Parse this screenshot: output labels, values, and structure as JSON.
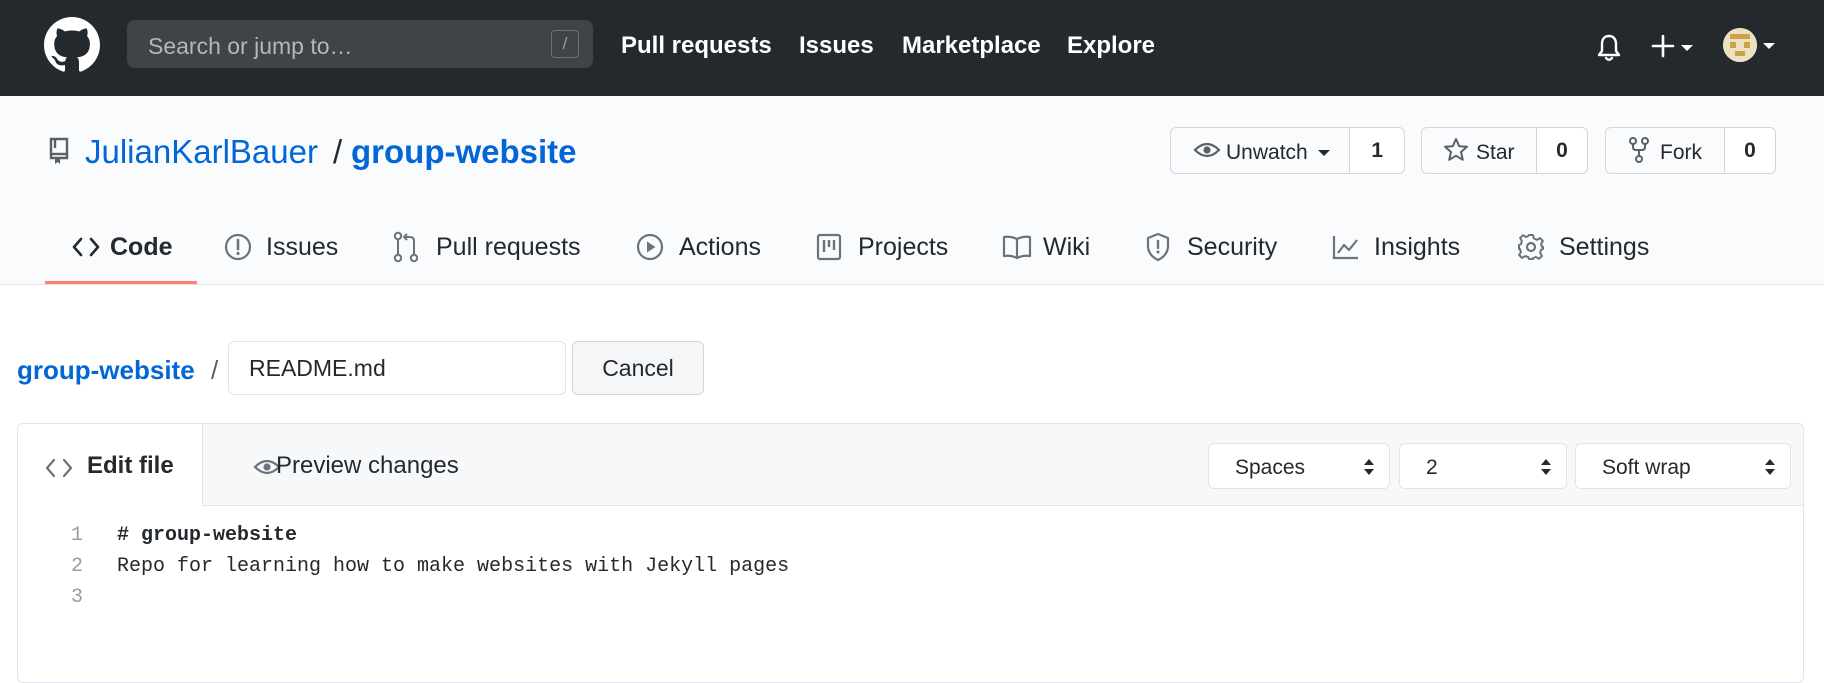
{
  "topnav": {
    "search_placeholder": "Search or jump to…",
    "search_shortcut": "/",
    "links": [
      "Pull requests",
      "Issues",
      "Marketplace",
      "Explore"
    ]
  },
  "repo": {
    "owner": "JulianKarlBauer",
    "separator": "/",
    "name": "group-website",
    "watch": {
      "label": "Unwatch",
      "count": "1"
    },
    "star": {
      "label": "Star",
      "count": "0"
    },
    "fork": {
      "label": "Fork",
      "count": "0"
    }
  },
  "tabs": [
    "Code",
    "Issues",
    "Pull requests",
    "Actions",
    "Projects",
    "Wiki",
    "Security",
    "Insights",
    "Settings"
  ],
  "active_tab": "Code",
  "breadcrumb": {
    "repo": "group-website",
    "separator": "/"
  },
  "filename": {
    "value": "README.md"
  },
  "cancel_label": "Cancel",
  "editor": {
    "edit_tab": "Edit file",
    "preview_tab": "Preview changes",
    "indent_mode": "Spaces",
    "indent_size": "2",
    "wrap_mode": "Soft wrap",
    "lines": [
      {
        "number": "1",
        "text": "# group-website"
      },
      {
        "number": "2",
        "text": "Repo for learning how to make websites with Jekyll pages"
      },
      {
        "number": "3",
        "text": ""
      }
    ]
  },
  "colors": {
    "header_bg": "#24292e",
    "link_blue": "#0366d6",
    "active_tab_underline": "#f9826c"
  }
}
